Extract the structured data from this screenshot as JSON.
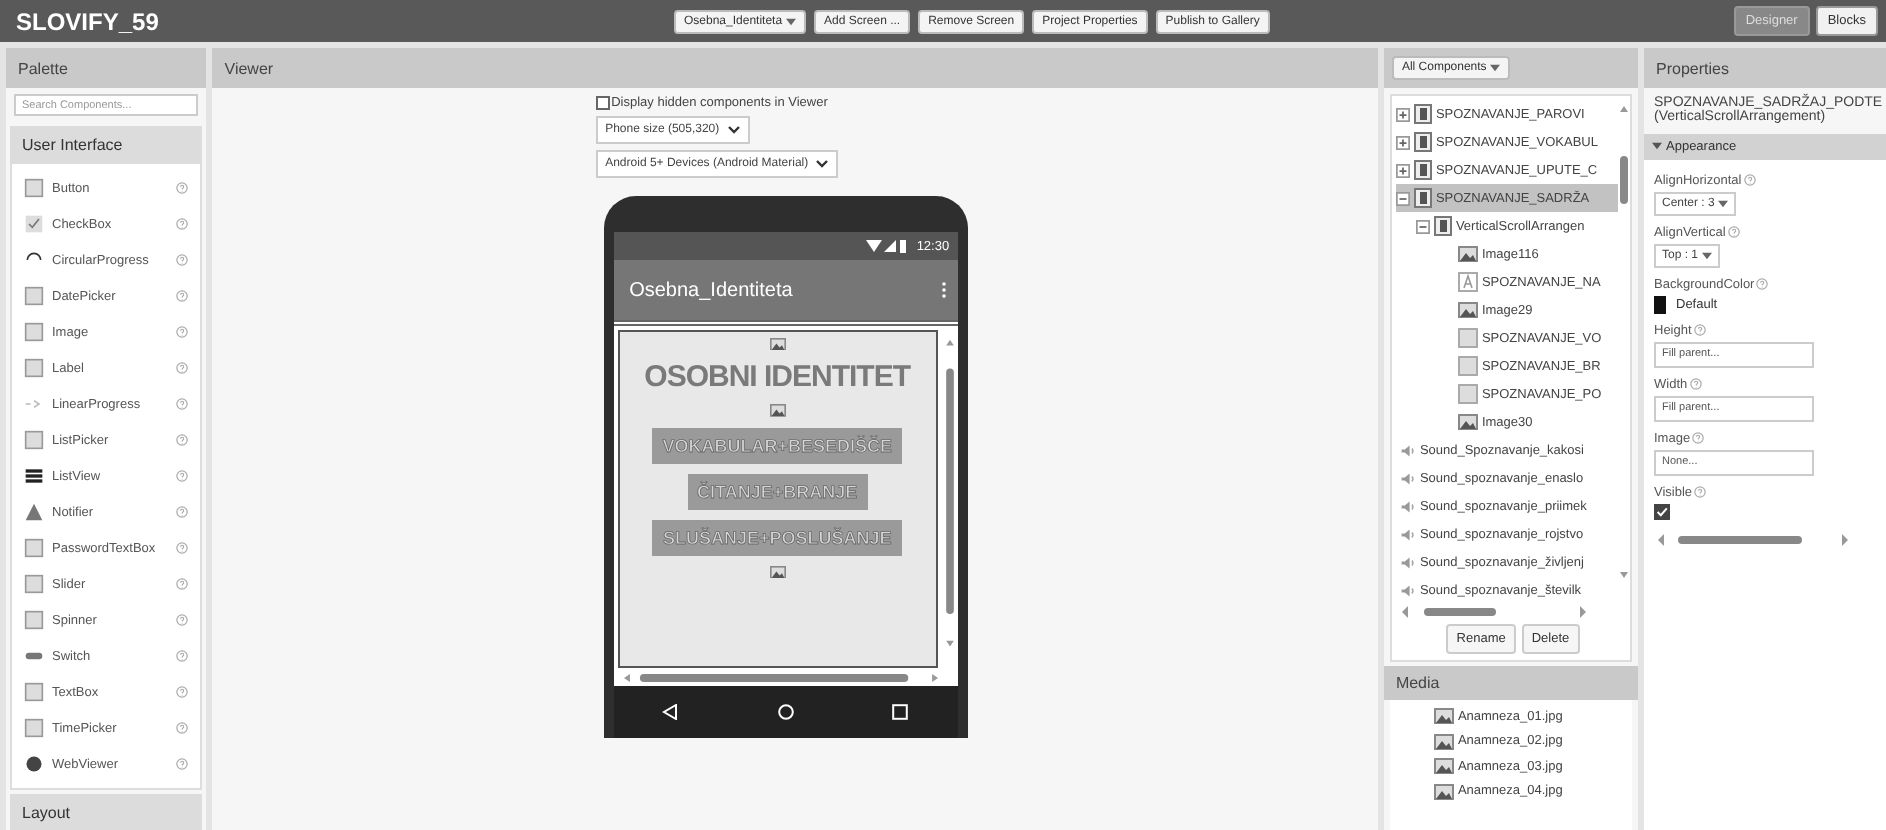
{
  "app": {
    "title": "SLOVIFY_59"
  },
  "toolbar": [
    {
      "kind": "dropdown",
      "label": "Osebna_Identiteta"
    },
    {
      "kind": "button",
      "label": "Add Screen ..."
    },
    {
      "kind": "button",
      "label": "Remove Screen"
    },
    {
      "kind": "button",
      "label": "Project Properties"
    },
    {
      "kind": "button",
      "label": "Publish to Gallery"
    }
  ],
  "modes": [
    {
      "label": "Designer",
      "selected": true
    },
    {
      "label": "Blocks",
      "selected": false
    }
  ],
  "palette": {
    "title": "Palette",
    "search": {
      "placeholder": "Search Components..."
    },
    "category": "User Interface",
    "next_category": "Layout",
    "items": [
      {
        "label": "Button",
        "kind": "button"
      },
      {
        "label": "CheckBox",
        "kind": "checkbox"
      },
      {
        "label": "CircularProgress",
        "kind": "circle"
      },
      {
        "label": "DatePicker",
        "kind": "calendar"
      },
      {
        "label": "Image",
        "kind": "image"
      },
      {
        "label": "Label",
        "kind": "label"
      },
      {
        "label": "LinearProgress",
        "kind": "dots"
      },
      {
        "label": "ListPicker",
        "kind": "list"
      },
      {
        "label": "ListView",
        "kind": "lines"
      },
      {
        "label": "Notifier",
        "kind": "warning"
      },
      {
        "label": "PasswordTextBox",
        "kind": "password"
      },
      {
        "label": "Slider",
        "kind": "slider"
      },
      {
        "label": "Spinner",
        "kind": "spinner"
      },
      {
        "label": "Switch",
        "kind": "switch"
      },
      {
        "label": "TextBox",
        "kind": "textbox"
      },
      {
        "label": "TimePicker",
        "kind": "calendar"
      },
      {
        "label": "WebViewer",
        "kind": "globe"
      }
    ]
  },
  "viewer": {
    "title": "Viewer",
    "hidden_checkbox": {
      "label": "Display hidden components in Viewer",
      "checked": false
    },
    "selects": [
      "Phone size (505,320)",
      "Android 5+ Devices (Android Material)"
    ],
    "phone": {
      "time": "12:30",
      "title": "Osebna_Identiteta",
      "content": [
        {
          "kind": "image"
        },
        {
          "kind": "heading",
          "text": "OSOBNI IDENTITET"
        },
        {
          "kind": "image"
        },
        {
          "kind": "button",
          "text": "VOKABULAR+BESEDIŠČE"
        },
        {
          "kind": "button",
          "text": "ČITANJE+BRANJE"
        },
        {
          "kind": "button",
          "text": "SLUŠANJE+POSLUŠANJE"
        },
        {
          "kind": "image"
        }
      ]
    }
  },
  "components": {
    "filter": "All Components",
    "tree": [
      {
        "label": "SPOZNAVANJE_PAROVI",
        "kind": "arrangement",
        "expanded": false,
        "selected": false
      },
      {
        "label": "SPOZNAVANJE_VOKABUL",
        "kind": "arrangement",
        "expanded": false,
        "selected": false
      },
      {
        "label": "SPOZNAVANJE_UPUTE_C",
        "kind": "arrangement",
        "expanded": false,
        "selected": false
      },
      {
        "label": "SPOZNAVANJE_SADRŽA",
        "kind": "arrangement",
        "expanded": true,
        "selected": true,
        "children": [
          {
            "label": "VerticalScrollArrangen",
            "kind": "arrangement",
            "expanded": true,
            "selected": false,
            "children": [
              {
                "label": "Image116",
                "kind": "image",
                "selected": false
              },
              {
                "label": "SPOZNAVANJE_NA",
                "kind": "label",
                "selected": false
              },
              {
                "label": "Image29",
                "kind": "image",
                "selected": false
              },
              {
                "label": "SPOZNAVANJE_VO",
                "kind": "button",
                "selected": false
              },
              {
                "label": "SPOZNAVANJE_BR",
                "kind": "button",
                "selected": false
              },
              {
                "label": "SPOZNAVANJE_PO",
                "kind": "button",
                "selected": false
              },
              {
                "label": "Image30",
                "kind": "image",
                "selected": false
              }
            ]
          }
        ]
      },
      {
        "label": "Sound_Spoznavanje_kakosi",
        "kind": "sound",
        "selected": false
      },
      {
        "label": "Sound_spoznavanje_enaslo",
        "kind": "sound",
        "selected": false
      },
      {
        "label": "Sound_spoznavanje_priimek",
        "kind": "sound",
        "selected": false
      },
      {
        "label": "Sound_spoznavanje_rojstvo",
        "kind": "sound",
        "selected": false
      },
      {
        "label": "Sound_spoznavanje_življenj",
        "kind": "sound",
        "selected": false
      },
      {
        "label": "Sound_spoznavanje_številk",
        "kind": "sound",
        "selected": false
      }
    ],
    "buttons": [
      "Rename",
      "Delete"
    ]
  },
  "media": {
    "title": "Media",
    "files": [
      "Anamneza_01.jpg",
      "Anamneza_02.jpg",
      "Anamneza_03.jpg",
      "Anamneza_04.jpg"
    ]
  },
  "properties": {
    "title": "Properties",
    "component": "SPOZNAVANJE_SADRŽAJ_PODTE",
    "type": "(VerticalScrollArrangement)",
    "section": "Appearance",
    "section_expanded": true,
    "items": [
      {
        "kind": "dropdown",
        "label": "AlignHorizontal",
        "value": "Center : 3"
      },
      {
        "kind": "dropdown",
        "label": "AlignVertical",
        "value": "Top : 1"
      },
      {
        "kind": "color",
        "label": "BackgroundColor",
        "value": "Default",
        "color": "#111111"
      },
      {
        "kind": "field",
        "label": "Height",
        "value": "Fill parent..."
      },
      {
        "kind": "field",
        "label": "Width",
        "value": "Fill parent..."
      },
      {
        "kind": "field",
        "label": "Image",
        "value": "None..."
      },
      {
        "kind": "checkbox",
        "label": "Visible",
        "checked": true
      }
    ]
  }
}
